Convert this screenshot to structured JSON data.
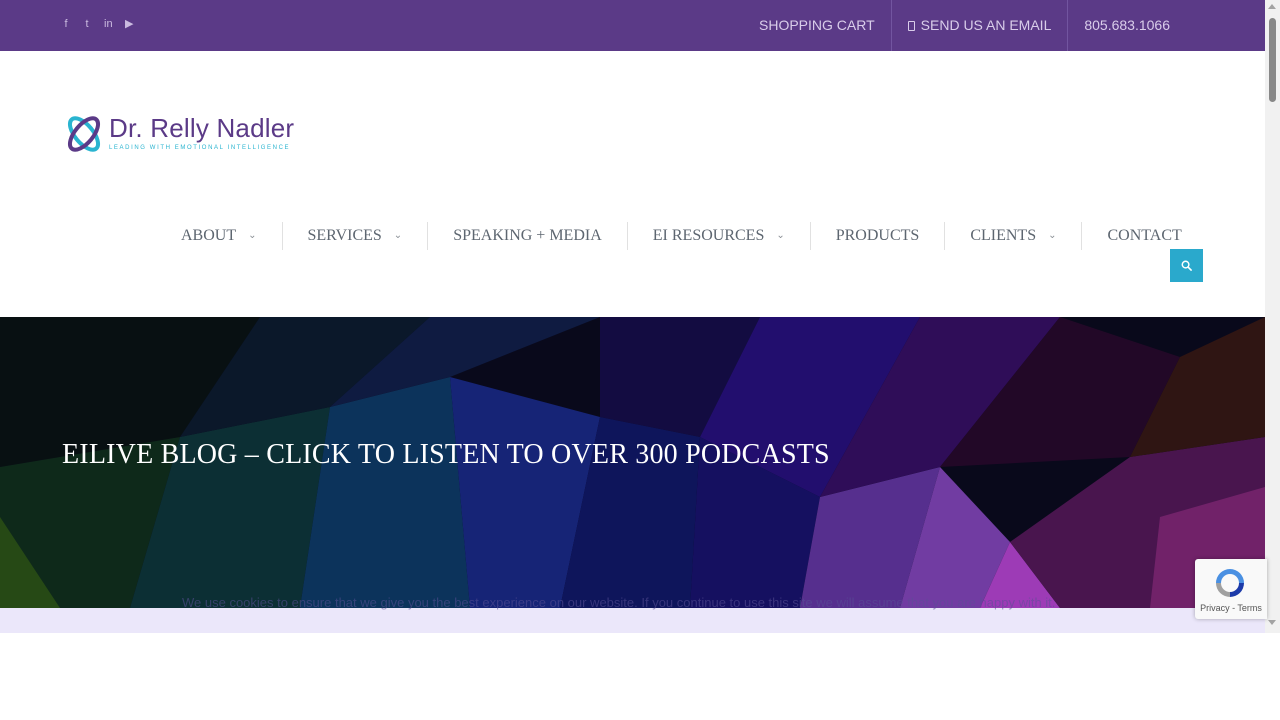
{
  "topbar": {
    "social_icons": [
      "facebook-icon",
      "twitter-icon",
      "linkedin-icon",
      "youtube-icon"
    ],
    "links": {
      "cart": "SHOPPING CART",
      "email": "SEND US AN EMAIL",
      "phone": "805.683.1066"
    },
    "bg_color": "#5b3a87"
  },
  "header": {
    "logo_name": "Dr. Relly Nadler",
    "logo_tagline": "LEADING WITH EMOTIONAL INTELLIGENCE"
  },
  "nav": {
    "items": [
      {
        "label": "ABOUT",
        "has_submenu": true
      },
      {
        "label": "SERVICES",
        "has_submenu": true
      },
      {
        "label": "SPEAKING + MEDIA",
        "has_submenu": false
      },
      {
        "label": "EI RESOURCES",
        "has_submenu": true
      },
      {
        "label": "PRODUCTS",
        "has_submenu": false
      },
      {
        "label": "CLIENTS",
        "has_submenu": true
      },
      {
        "label": "CONTACT",
        "has_submenu": false
      }
    ],
    "search_icon": "search-icon",
    "accent_color": "#2aa9cc"
  },
  "hero": {
    "title": "EILIVE BLOG – CLICK TO LISTEN TO OVER 300 PODCASTS"
  },
  "cookie_notice": {
    "text": "We use cookies to ensure that we give you the best experience on our website. If you continue to use this site we will assume that you are happy with it."
  },
  "recaptcha": {
    "footer": "Privacy - Terms"
  }
}
